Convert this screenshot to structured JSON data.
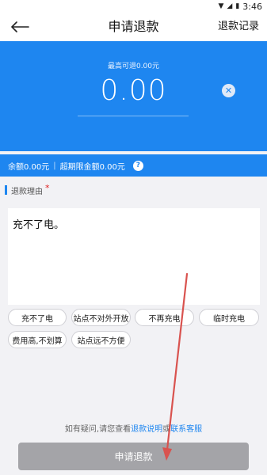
{
  "status_bar": {
    "time": "3:46"
  },
  "header": {
    "title": "申请退款",
    "history_link": "退款记录"
  },
  "refund_panel": {
    "max_refund_text": "最高可退0.00元",
    "amount": "0.00"
  },
  "balance_bar": {
    "balance": "余额0.00元",
    "overdue_limit": "超期限金额0.00元"
  },
  "reason": {
    "label": "退款理由",
    "required_mark": "*",
    "text": "充不了电。",
    "quick_options": [
      "充不了电",
      "站点不对外开放",
      "不再充电",
      "临时充电",
      "费用高,不划算",
      "站点远不方便"
    ]
  },
  "help": {
    "prefix": "如有疑问,请您查看",
    "link_explain": "退款说明",
    "or": "或",
    "link_service": "联系客服"
  },
  "submit": {
    "label": "申请退款"
  },
  "colors": {
    "primary": "#1e86f0",
    "submit_disabled": "#a4a4a8",
    "required": "#e02020",
    "annotation": "#d9534f"
  },
  "icons": {
    "back": "arrow-left-icon",
    "clear": "close-circle-icon",
    "help": "question-circle-icon",
    "wifi": "wifi-icon",
    "signal": "signal-icon",
    "battery": "battery-icon"
  }
}
